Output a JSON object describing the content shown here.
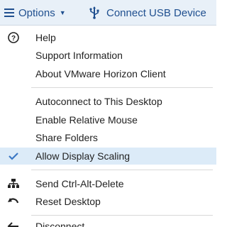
{
  "toolbar": {
    "options_label": "Options",
    "connect_usb_label": "Connect USB Device"
  },
  "menu": {
    "items": [
      {
        "label": "Help",
        "icon": "help-icon"
      },
      {
        "label": "Support Information"
      },
      {
        "label": "About VMware Horizon Client"
      },
      {
        "label": "Autoconnect to This Desktop"
      },
      {
        "label": "Enable Relative Mouse"
      },
      {
        "label": "Share Folders"
      },
      {
        "label": "Allow Display Scaling",
        "icon": "checkmark-icon",
        "checked": true
      },
      {
        "label": "Send Ctrl-Alt-Delete",
        "icon": "network-icon"
      },
      {
        "label": "Reset Desktop",
        "icon": "reset-icon"
      },
      {
        "label": "Disconnect",
        "icon": "disconnect-arrow-icon"
      }
    ]
  },
  "colors": {
    "toolbar_bg": "#e8f0f8",
    "toolbar_text": "#1f4f8f",
    "checked_bg": "#dcebf8",
    "check_color": "#3b78c4"
  }
}
